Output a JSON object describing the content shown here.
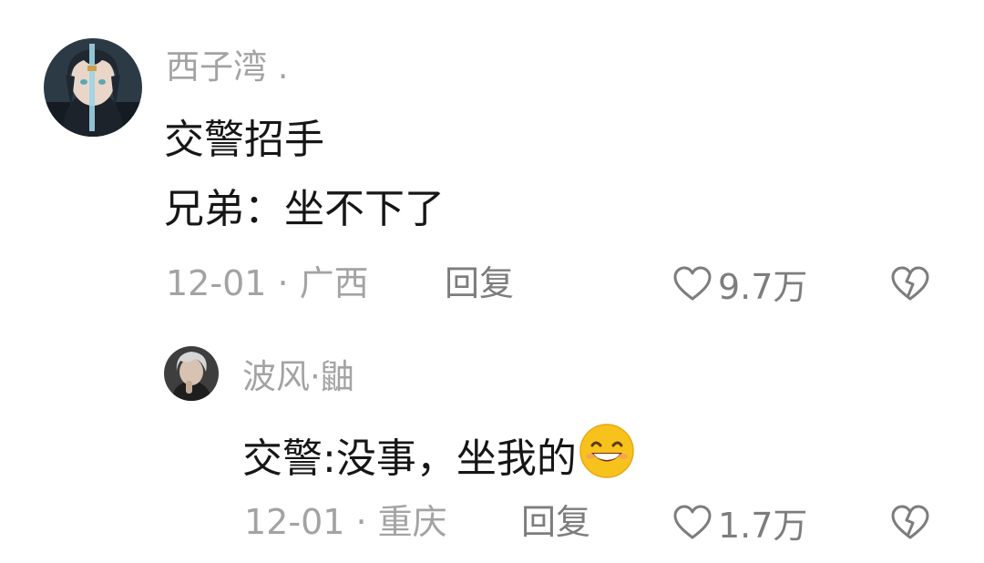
{
  "comments": [
    {
      "username": "西子湾 .",
      "text_lines": [
        "交警招手",
        "兄弟：坐不下了"
      ],
      "date": "12-01",
      "location": "广西",
      "reply_label": "回复",
      "like_count": "9.7万",
      "icons": {
        "avatar": "anime-avatar",
        "like": "heart-outline-icon",
        "dislike": "broken-heart-icon"
      }
    },
    {
      "username": "波风·鼬",
      "text": "交警:没事，坐我的",
      "emoji": "grinning-face",
      "date": "12-01",
      "location": "重庆",
      "reply_label": "回复",
      "like_count": "1.7万",
      "icons": {
        "avatar": "person-avatar",
        "like": "heart-outline-icon",
        "dislike": "broken-heart-icon"
      }
    }
  ],
  "meta_separator": " · ",
  "colors": {
    "text": "#161616",
    "secondary": "#a3a3a3",
    "action": "#7d7d7d",
    "background": "#ffffff"
  }
}
